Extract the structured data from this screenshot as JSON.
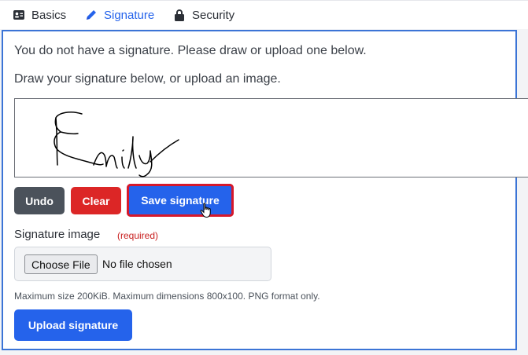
{
  "tabs": [
    {
      "label": "Basics",
      "icon": "id-card-icon"
    },
    {
      "label": "Signature",
      "icon": "pencil-icon",
      "active": true
    },
    {
      "label": "Security",
      "icon": "lock-icon"
    }
  ],
  "panel": {
    "notice": "You do not have a signature. Please draw or upload one below.",
    "instructions": "Draw your signature below, or upload an image.",
    "pad_drawing": "Emily",
    "buttons": {
      "undo": "Undo",
      "clear": "Clear",
      "save": "Save signature"
    },
    "image_label": "Signature image",
    "required": "(required)",
    "file": {
      "choose": "Choose File",
      "status": "No file chosen"
    },
    "help": "Maximum size 200KiB. Maximum dimensions 800x100. PNG format only.",
    "upload": "Upload signature"
  },
  "colors": {
    "accent": "#2563eb",
    "danger": "#dc2626",
    "secondary": "#4b525b",
    "highlight": "#d6182b"
  }
}
